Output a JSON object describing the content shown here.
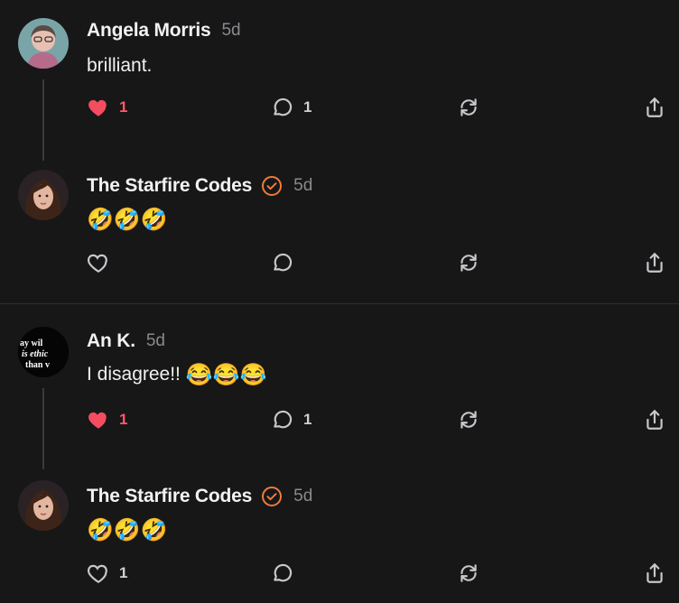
{
  "colors": {
    "background": "#171718",
    "like_active": "#f34d5f",
    "verified_badge": "#ef7b3a",
    "icon": "#c8c8cc"
  },
  "comments": [
    {
      "author": "Angela Morris",
      "time": "5d",
      "text": "brilliant.",
      "emojis": "",
      "verified": false,
      "liked": true,
      "likes": "1",
      "replies": "1",
      "avatar": "woman-with-glasses"
    },
    {
      "author": "The Starfire Codes",
      "time": "5d",
      "text": "",
      "emojis": "🤣🤣🤣",
      "verified": true,
      "liked": false,
      "likes": "",
      "replies": "",
      "avatar": "woman-dark-hair"
    },
    {
      "author": "An K.",
      "time": "5d",
      "text": "I disagree!!",
      "emojis": "😂😂😂",
      "verified": false,
      "liked": true,
      "likes": "1",
      "replies": "1",
      "avatar_text": [
        "ay wil",
        "is ethic",
        "than v"
      ]
    },
    {
      "author": "The Starfire Codes",
      "time": "5d",
      "text": "",
      "emojis": "🤣🤣🤣",
      "verified": true,
      "liked": false,
      "likes": "1",
      "replies": "",
      "avatar": "woman-dark-hair"
    }
  ]
}
